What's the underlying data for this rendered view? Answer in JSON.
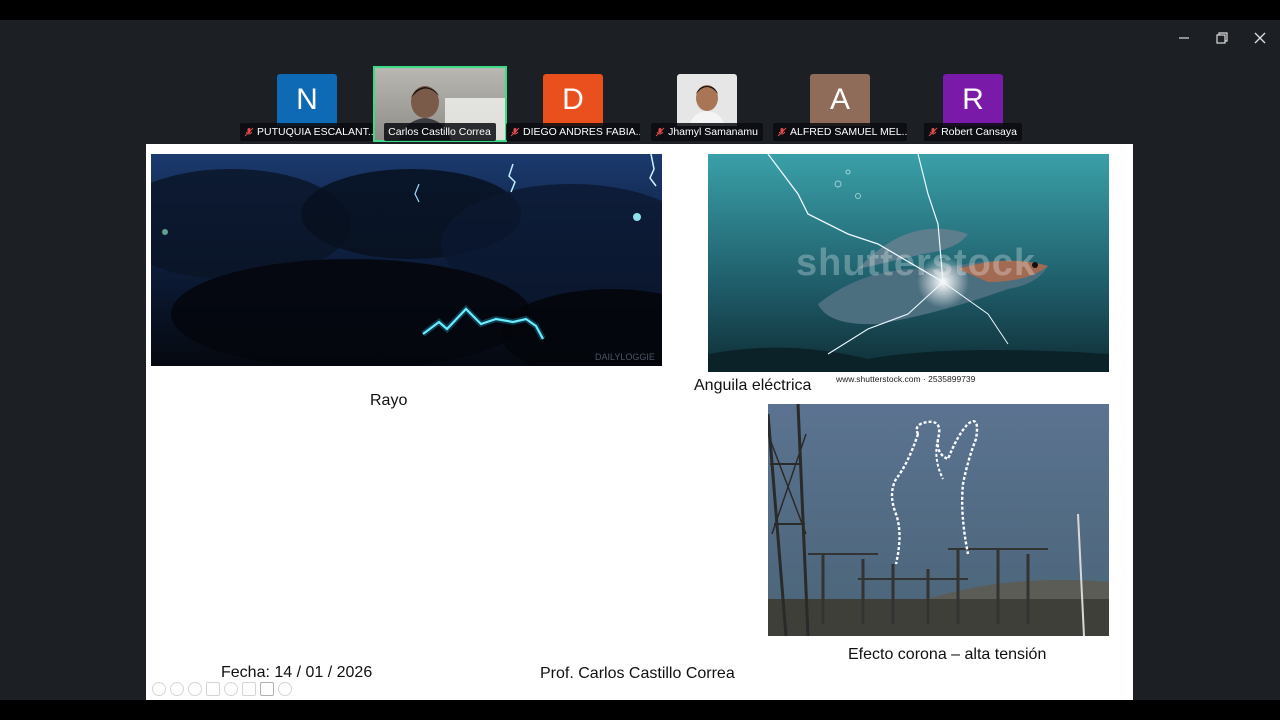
{
  "participants": [
    {
      "initial": "N",
      "name": "PUTUQUIA ESCALANT...",
      "color": "#0e6ab5",
      "video": false
    },
    {
      "initial": "",
      "name": "Carlos Castillo Correa",
      "color": "#8a8a86",
      "video": true
    },
    {
      "initial": "D",
      "name": "DIEGO ANDRES FABIA...",
      "color": "#e9501e",
      "video": false
    },
    {
      "initial": "",
      "name": "Jhamyl Samanamu",
      "color": "#cfcfcf",
      "video": true
    },
    {
      "initial": "A",
      "name": "ALFRED SAMUEL MEL...",
      "color": "#8f6b5a",
      "video": false
    },
    {
      "initial": "R",
      "name": "Robert Cansaya",
      "color": "#7a1aa8",
      "video": false
    }
  ],
  "slide": {
    "caption_rayo": "Rayo",
    "caption_anguila": "Anguila eléctrica",
    "caption_corona": "Efecto corona – alta tensión",
    "eel_credit": "www.shutterstock.com · 2535899739",
    "eel_watermark": "shutterstock",
    "lightning_watermark": "DAILYLOGGIE",
    "fecha": "Fecha: 14 / 01  / 2026",
    "profesor": "Prof. Carlos Castillo Correa"
  },
  "colors": {
    "active_speaker": "#3ddc84",
    "background": "#1c1f24"
  }
}
